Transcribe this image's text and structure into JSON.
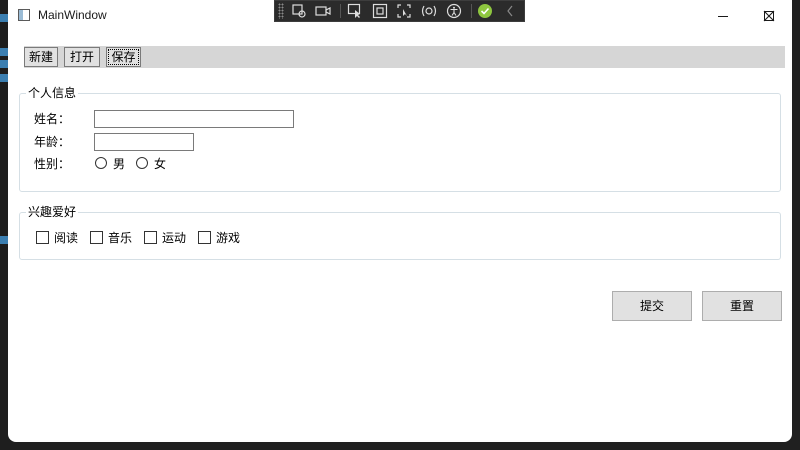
{
  "window": {
    "title": "MainWindow"
  },
  "toolbar": {
    "new_label": "新建",
    "open_label": "打开",
    "save_label": "保存"
  },
  "personal_info": {
    "group_title": "个人信息",
    "name_label": "姓名：",
    "name_value": "",
    "age_label": "年龄：",
    "age_value": "",
    "gender_label": "性别：",
    "gender_options": [
      "男",
      "女"
    ]
  },
  "hobbies": {
    "group_title": "兴趣爱好",
    "options": [
      "阅读",
      "音乐",
      "运动",
      "游戏"
    ]
  },
  "actions": {
    "submit_label": "提交",
    "reset_label": "重置"
  },
  "colors": {
    "toolbar_bg": "#d6d6d6",
    "groupbox_border": "#d5dfe5",
    "button_bg": "#e1e1e1"
  }
}
